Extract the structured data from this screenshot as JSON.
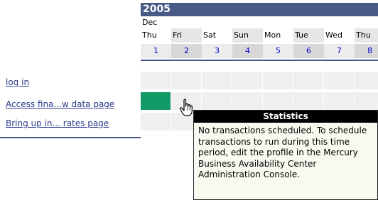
{
  "calendar": {
    "year": "2005",
    "month": "Dec",
    "days_of_week": [
      "Thu",
      "Fri",
      "Sat",
      "Sun",
      "Mon",
      "Tue",
      "Wed",
      "Thu"
    ],
    "dates": [
      "1",
      "2",
      "3",
      "4",
      "5",
      "6",
      "7",
      "8"
    ]
  },
  "rows": [
    {
      "label": "log in"
    },
    {
      "label": "Access fina...w data page"
    },
    {
      "label": "Bring up in... rates page"
    }
  ],
  "tooltip": {
    "title": "Statistics",
    "text": "No transactions scheduled. To schedule transactions to run during this time period, edit the profile in the Mercury Business Availability Center Administration Console."
  },
  "colors": {
    "header": "#4a5a87",
    "active_cell": "#119966"
  },
  "icons": [
    "hand-pointer-icon"
  ]
}
